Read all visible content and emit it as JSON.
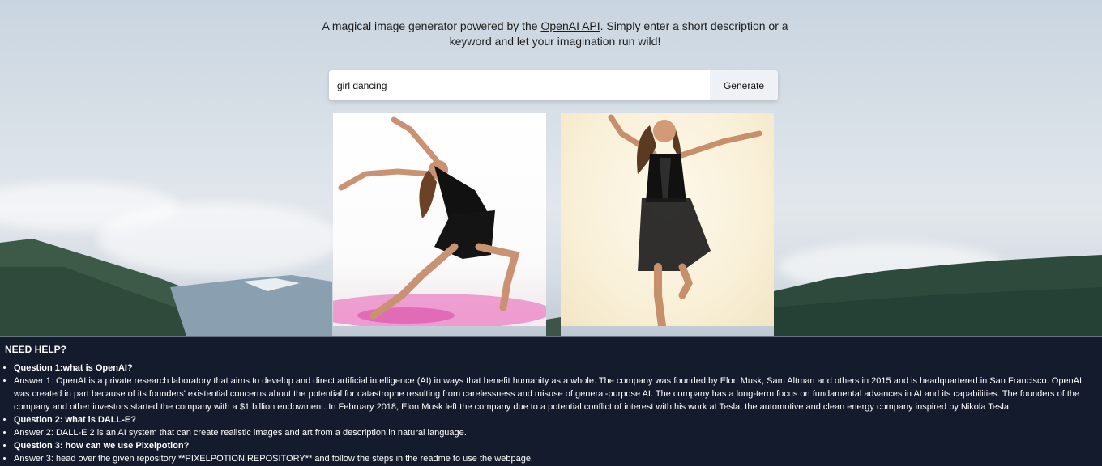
{
  "hero": {
    "text_before_link": "A magical image generator powered by the ",
    "link_text": "OpenAI API",
    "text_after_link": ". Simply enter a short description or a keyword and let your imagination run wild!"
  },
  "search": {
    "value": "girl dancing",
    "placeholder": "",
    "button_label": "Generate"
  },
  "images": [
    {
      "alt": "girl dancing result 1"
    },
    {
      "alt": "girl dancing result 2"
    }
  ],
  "help": {
    "title": "NEED HELP?",
    "items": [
      {
        "type": "q",
        "text": "Question 1:what is OpenAI?"
      },
      {
        "type": "a",
        "text": "Answer 1: OpenAI is a private research laboratory that aims to develop and direct artificial intelligence (AI) in ways that benefit humanity as a whole. The company was founded by Elon Musk, Sam Altman and others in 2015 and is headquartered in San Francisco. OpenAI was created in part because of its founders' existential concerns about the potential for catastrophe resulting from carelessness and misuse of general-purpose AI. The company has a long-term focus on fundamental advances in AI and its capabilities. The founders of the company and other investors started the company with a $1 billion endowment. In February 2018, Elon Musk left the company due to a potential conflict of interest with his work at Tesla, the automotive and clean energy company inspired by Nikola Tesla."
      },
      {
        "type": "q",
        "text": "Question 2: what is DALL-E?"
      },
      {
        "type": "a",
        "text": "Answer 2: DALL-E 2 is an AI system that can create realistic images and art from a description in natural language."
      },
      {
        "type": "q",
        "text": "Question 3: how can we use Pixelpotion?"
      },
      {
        "type": "a",
        "text": "Answer 3: head over the given repository **PIXELPOTION REPOSITORY** and follow the steps in the readme to use the webpage."
      }
    ]
  }
}
